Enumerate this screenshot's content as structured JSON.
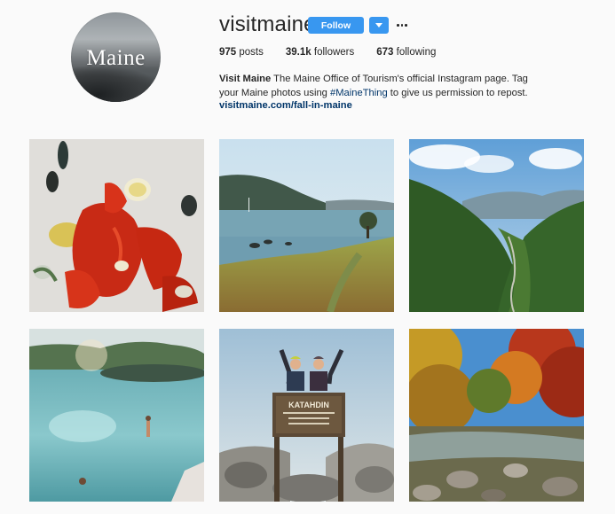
{
  "profile": {
    "avatar_text": "Maine",
    "username": "visitmaine",
    "follow_label": "Follow",
    "more_icon": "more-horizontal-icon",
    "dropdown_icon": "chevron-down-icon",
    "accent_color": "#3897f0"
  },
  "stats": {
    "posts_count": "975",
    "posts_label": "posts",
    "followers_count": "39.1k",
    "followers_label": "followers",
    "following_count": "673",
    "following_label": "following"
  },
  "bio": {
    "name": "Visit Maine",
    "text_before_tag": "The Maine Office of Tourism's official Instagram page. Tag your Maine photos using ",
    "hashtag": "#MaineThing",
    "text_after_tag": " to give us permission to repost.",
    "link": "visitmaine.com/fall-in-maine"
  },
  "posts": [
    {
      "subject": "lobster feast"
    },
    {
      "subject": "coastal lake shore"
    },
    {
      "subject": "mountain valley"
    },
    {
      "subject": "swimmers in the sea"
    },
    {
      "subject": "Katahdin summit"
    },
    {
      "subject": "autumn stream"
    }
  ],
  "katahdin_sign": {
    "title": "KATAHDIN"
  }
}
